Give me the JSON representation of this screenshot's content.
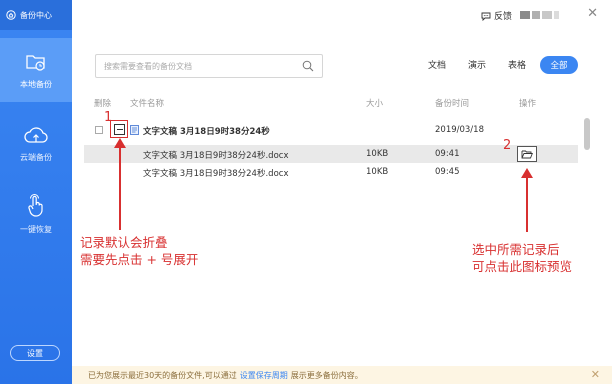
{
  "app": {
    "title": "备份中心"
  },
  "sidebar": {
    "items": [
      {
        "label": "本地备份",
        "icon": "folder-clock-icon",
        "active": true
      },
      {
        "label": "云端备份",
        "icon": "cloud-upload-icon",
        "active": false
      },
      {
        "label": "一键恢复",
        "icon": "hand-pointer-icon",
        "active": false
      }
    ],
    "settings_label": "设置"
  },
  "topbar": {
    "feedback_label": "反馈"
  },
  "search": {
    "placeholder": "搜索需要查看的备份文档"
  },
  "filters": {
    "doc": "文档",
    "slides": "演示",
    "sheets": "表格",
    "all": "全部"
  },
  "table": {
    "headers": {
      "delete": "删除",
      "filename": "文件名称",
      "size": "大小",
      "time": "备份时间",
      "action": "操作"
    },
    "group": {
      "name": "文字文稿 3月18日9时38分24秒",
      "date": "2019/03/18"
    },
    "rows": [
      {
        "name": "文字文稿 3月18日9时38分24秒.docx",
        "size": "10KB",
        "time": "09:41"
      },
      {
        "name": "文字文稿 3月18日9时38分24秒.docx",
        "size": "10KB",
        "time": "09:45"
      }
    ]
  },
  "annotations": {
    "num1": "1",
    "num2": "2",
    "left_line1": "记录默认会折叠",
    "left_line2": "需要先点击 + 号展开",
    "right_line1": "选中所需记录后",
    "right_line2": "可点击此图标预览"
  },
  "bottom_bar": {
    "text_before": "已为您展示最近30天的备份文件,可以通过",
    "link": "设置保存周期",
    "text_after": "展示更多备份内容。"
  },
  "colors": {
    "accent": "#3b86f2",
    "annotation": "#d83030",
    "notice_bg": "#fdf5e3"
  }
}
